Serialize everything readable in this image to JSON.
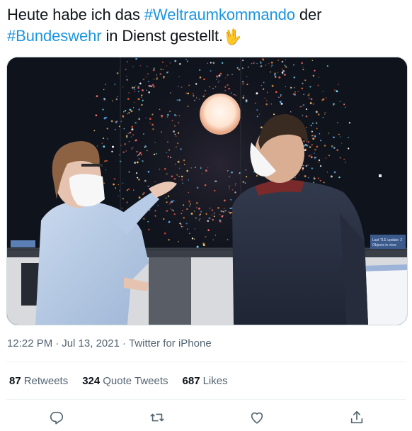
{
  "tweet": {
    "text_before": "Heute habe ich das ",
    "hashtag1": "#Weltraumkommando",
    "text_mid": " der",
    "hashtag2": "#Bundeswehr",
    "text_after": " in Dienst gestellt.",
    "emoji": "🖖"
  },
  "media": {
    "screen_text": [
      "Last TLE update: 2",
      "Objects in view"
    ]
  },
  "meta": {
    "time": "12:22 PM",
    "date": "Jul 13, 2021",
    "source": "Twitter for iPhone",
    "separator": "·"
  },
  "stats": {
    "retweets_count": "87",
    "retweets_label": "Retweets",
    "quotes_count": "324",
    "quotes_label": "Quote Tweets",
    "likes_count": "687",
    "likes_label": "Likes"
  },
  "actions": [
    "reply-icon",
    "retweet-icon",
    "like-icon",
    "share-icon"
  ],
  "colors": {
    "link": "#1b95e0",
    "muted": "#536471",
    "text": "#0f1419"
  }
}
